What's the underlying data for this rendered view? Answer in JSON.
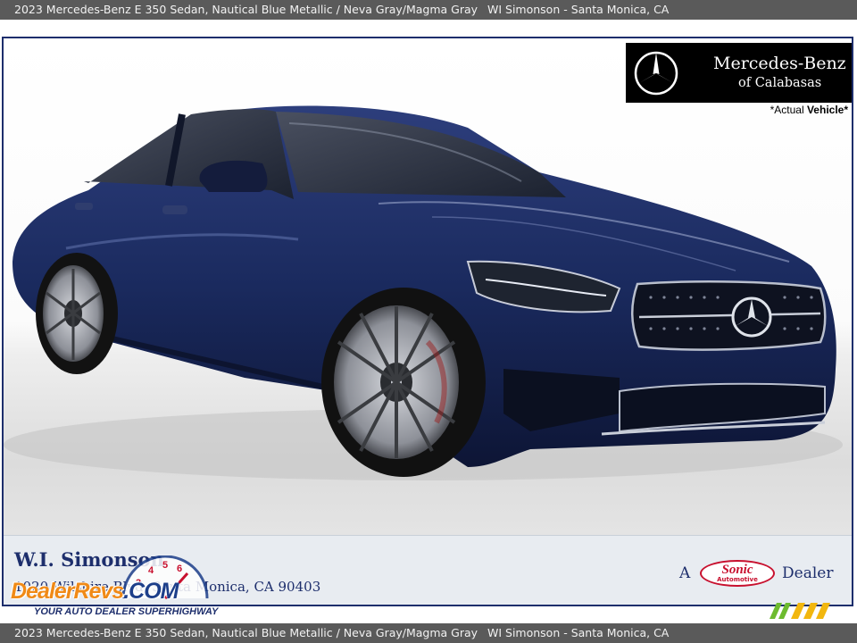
{
  "top_bar": {
    "vehicle": "2023 Mercedes-Benz E 350 Sedan,   Nautical Blue Metallic  /  Neva Gray/Magma Gray",
    "dealer_location": "WI Simonson  -  Santa Monica, CA"
  },
  "bottom_bar": {
    "vehicle": "2023 Mercedes-Benz E 350 Sedan,   Nautical Blue Metallic  /  Neva Gray/Magma Gray",
    "dealer_location": "WI Simonson  -  Santa Monica, CA"
  },
  "dealer_logo": {
    "line1": "Mercedes-Benz",
    "line2": "of Calabasas"
  },
  "actual_vehicle_note": {
    "prefix": "*Actual ",
    "emphasis": "Vehicle*"
  },
  "dealer_banner": {
    "name": "W.I. Simonson",
    "address": "1020 Wilshire Blvd, Santa Monica, CA 90403",
    "sonic_prefix": "A",
    "sonic_brand": "Sonic",
    "sonic_sub": "Automotive",
    "sonic_suffix": "Dealer"
  },
  "watermark": {
    "brand": "DealerRevs",
    "tld": ".COM",
    "tagline": "YOUR AUTO DEALER SUPERHIGHWAY"
  },
  "colors": {
    "bar_background": "#5a5a5a",
    "frame_border": "#1d2e6c",
    "car_paint": "#1a2a5e",
    "banner_background": "#e8ecf1",
    "sonic_red": "#c8102e",
    "watermark_orange": "#f08a17"
  }
}
